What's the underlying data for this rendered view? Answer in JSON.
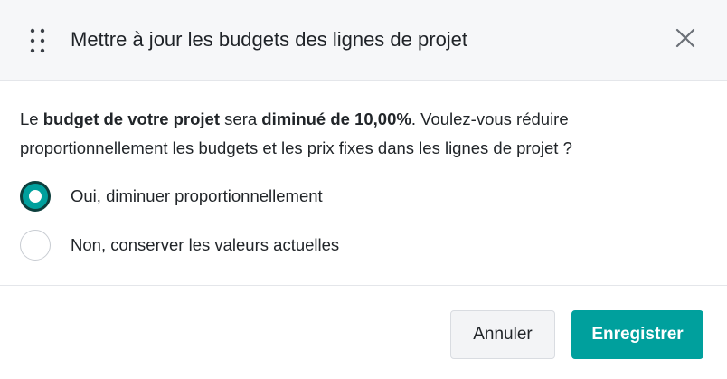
{
  "dialog": {
    "title": "Mettre à jour les budgets des lignes de projet",
    "close_icon": "close-icon",
    "drag_icon": "drag-handle-icon"
  },
  "message": {
    "part1": "Le ",
    "bold1": "budget de votre projet",
    "part2": " sera ",
    "bold2": "diminué de 10,00%",
    "part3": ". Voulez-vous réduire proportionnellement les budgets et les prix fixes dans les lignes de projet ?"
  },
  "options": [
    {
      "label": "Oui, diminuer proportionnellement",
      "selected": true
    },
    {
      "label": "Non, conserver les valeurs actuelles",
      "selected": false
    }
  ],
  "footer": {
    "cancel_label": "Annuler",
    "save_label": "Enregistrer"
  },
  "colors": {
    "accent": "#00a09d",
    "accent_dark": "#0d3f3d",
    "header_bg": "#f6f7f9"
  }
}
